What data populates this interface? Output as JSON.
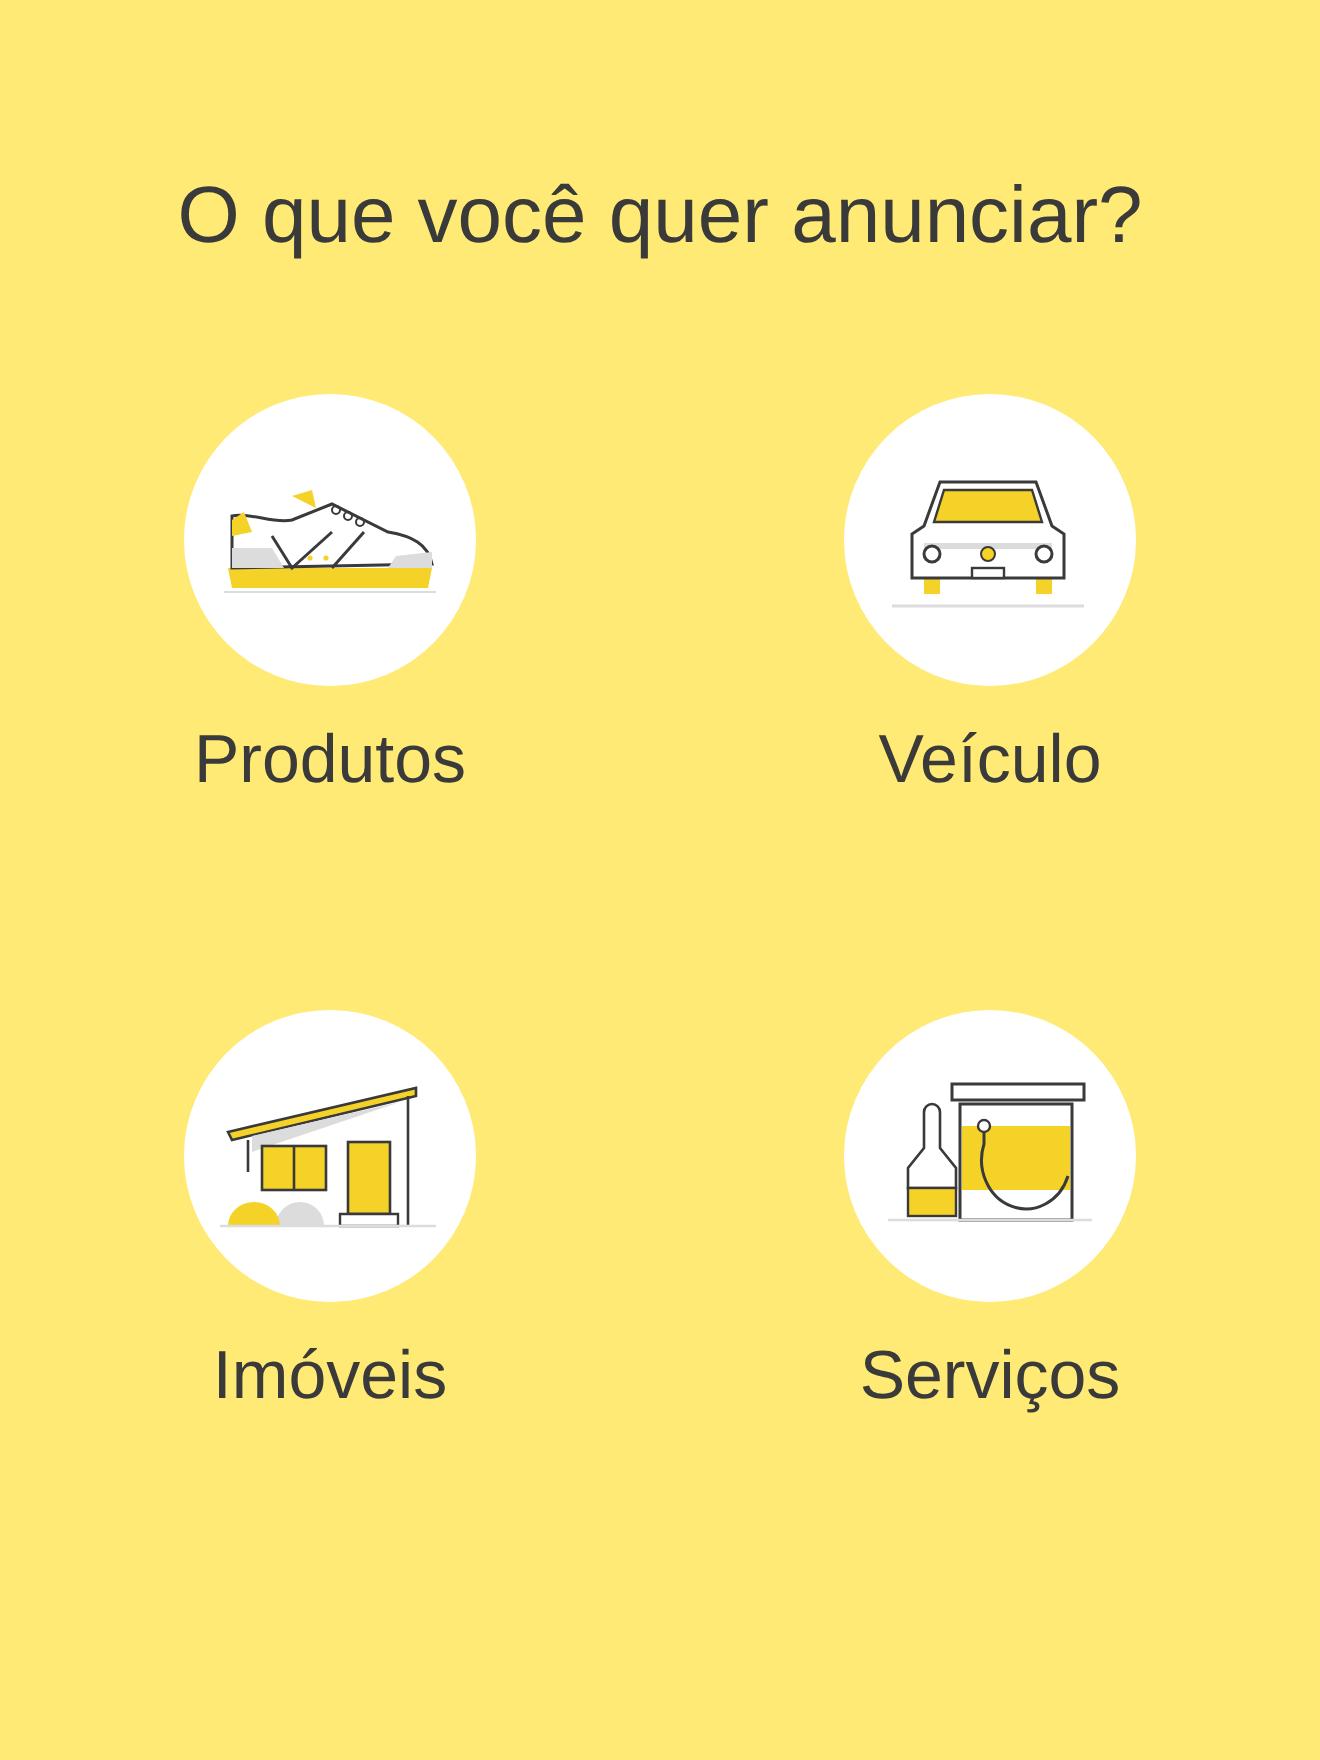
{
  "title": "O que você quer anunciar?",
  "categories": [
    {
      "label": "Produtos",
      "kind": "shoe"
    },
    {
      "label": "Veículo",
      "kind": "car"
    },
    {
      "label": "Imóveis",
      "kind": "house"
    },
    {
      "label": "Serviços",
      "kind": "paint"
    }
  ]
}
